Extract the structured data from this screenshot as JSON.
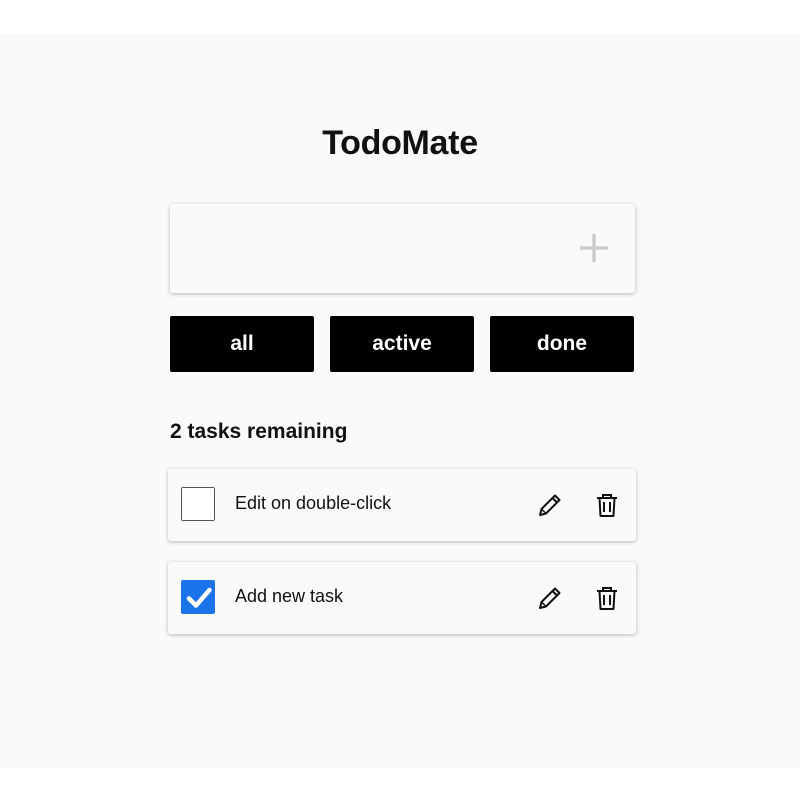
{
  "app": {
    "title": "TodoMate"
  },
  "add_task": {
    "value": "",
    "placeholder": "",
    "add_icon": "plus-icon",
    "icon_color": "#cccccc"
  },
  "filters": [
    {
      "label": "all"
    },
    {
      "label": "active"
    },
    {
      "label": "done"
    }
  ],
  "status": {
    "remaining_text": "2 tasks remaining"
  },
  "tasks": [
    {
      "text": "Edit on double-click",
      "done": false,
      "edit_icon": "pencil-icon",
      "delete_icon": "trash-icon"
    },
    {
      "text": "Add new task",
      "done": true,
      "edit_icon": "pencil-icon",
      "delete_icon": "trash-icon"
    }
  ],
  "colors": {
    "button_bg": "#000000",
    "button_text": "#ffffff",
    "checkbox_checked": "#1a73e8",
    "page_bg": "#fafafa"
  }
}
